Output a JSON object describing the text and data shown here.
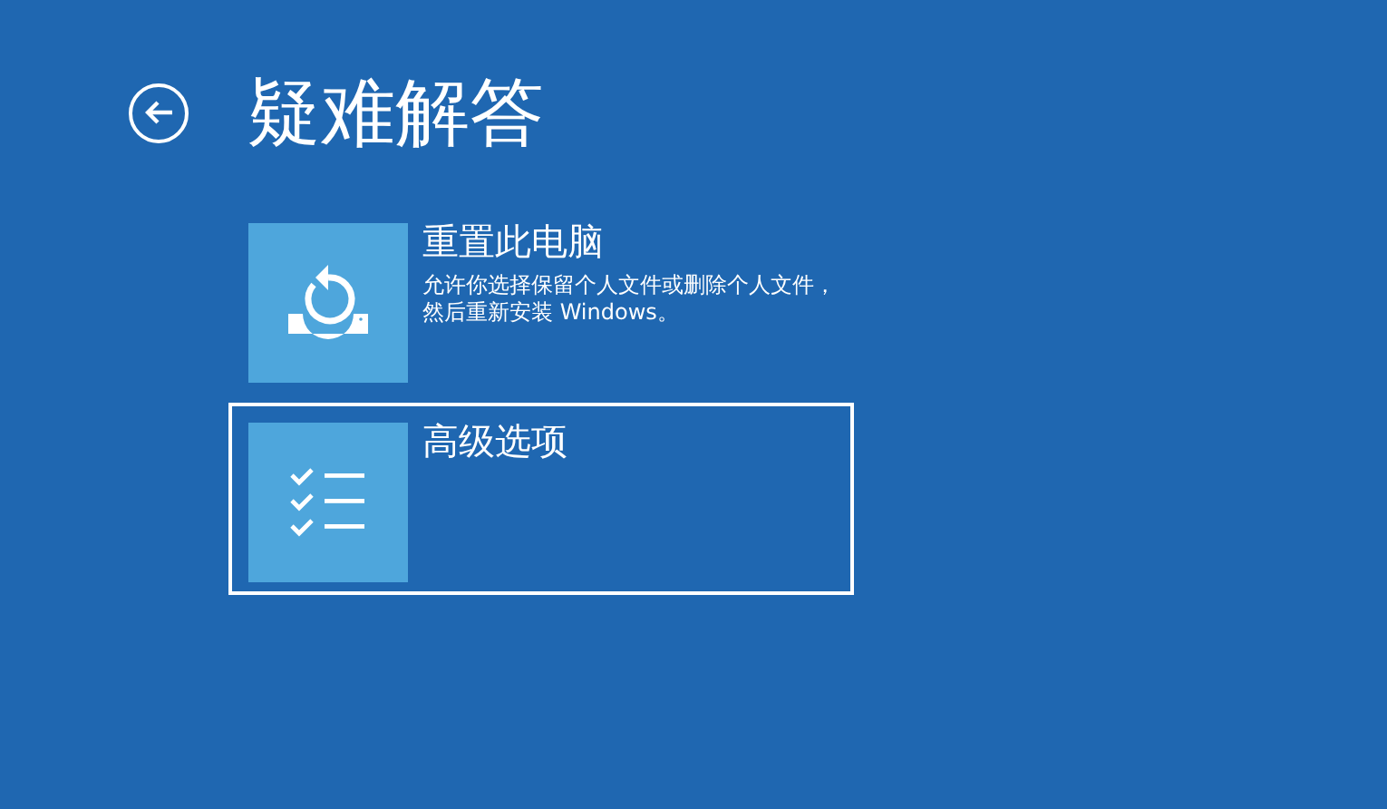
{
  "title": "疑难解答",
  "options": [
    {
      "kind": "reset",
      "title": "重置此电脑",
      "description": "允许你选择保留个人文件或删除个人文件，然后重新安装 Windows。",
      "selected": false
    },
    {
      "kind": "advanced",
      "title": "高级选项",
      "selected": true
    }
  ]
}
